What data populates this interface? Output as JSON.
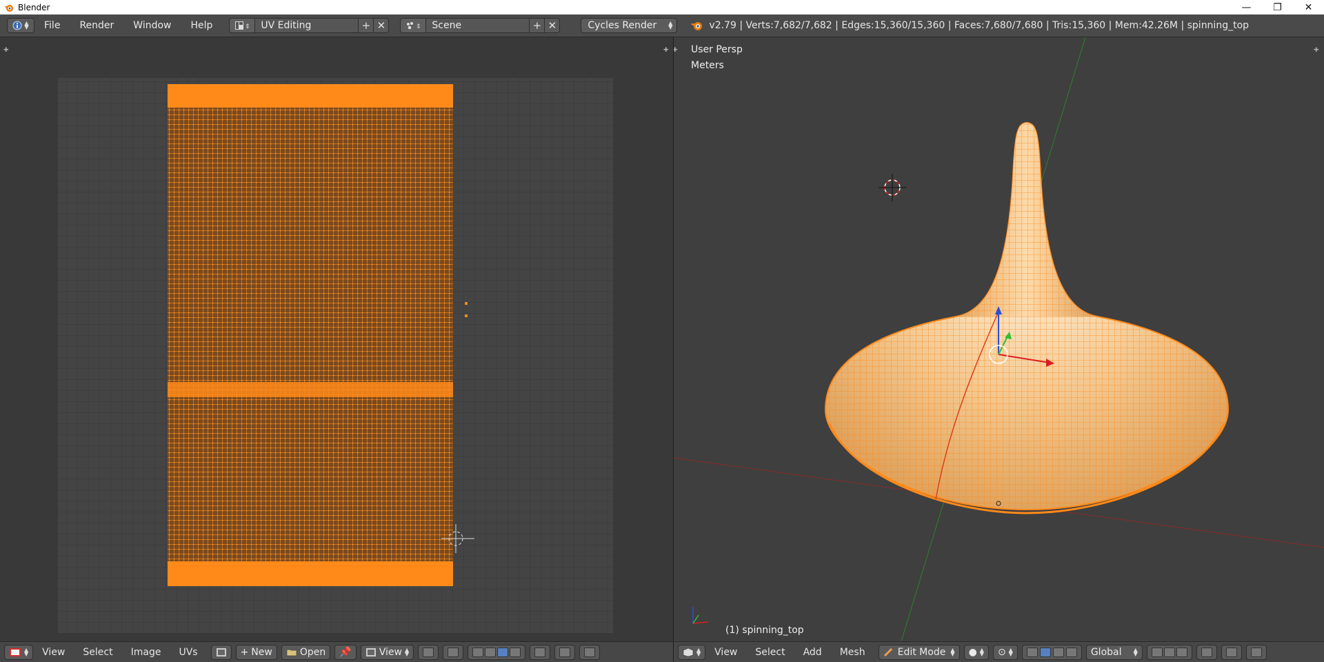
{
  "os_window": {
    "title": "Blender",
    "minimize_glyph": "—",
    "maximize_glyph": "❐",
    "close_glyph": "✕"
  },
  "info_header": {
    "menus": [
      "File",
      "Render",
      "Window",
      "Help"
    ],
    "workspace": "UV Editing",
    "scene": "Scene",
    "render_engine": "Cycles Render",
    "stats": "v2.79 | Verts:7,682/7,682 | Edges:15,360/15,360 | Faces:7,680/7,680 | Tris:15,360 | Mem:42.26M | spinning_top",
    "add_glyph": "+",
    "remove_glyph": "✕"
  },
  "uv_editor": {
    "menus": [
      "View",
      "Select",
      "Image",
      "UVs"
    ],
    "new_label": "New",
    "open_label": "Open",
    "view_label": "View"
  },
  "viewport": {
    "view_name": "User Persp",
    "units": "Meters",
    "object_label": "(1) spinning_top",
    "menus": [
      "View",
      "Select",
      "Add",
      "Mesh"
    ],
    "mode": "Edit Mode",
    "orientation": "Global"
  },
  "colors": {
    "accent_orange": "#ff8a1a",
    "mesh_fill": "#f2c48a",
    "grid_line": "#4a4a4a",
    "uv_bg": "#444444"
  },
  "icons": {
    "blender_logo": "blender-logo-icon",
    "editor_info": "info-icon",
    "workspace": "screen-layout-icon",
    "scene": "scene-icon",
    "3d_cursor": "cursor-3d-icon",
    "manipulator": "transform-widget-icon"
  }
}
